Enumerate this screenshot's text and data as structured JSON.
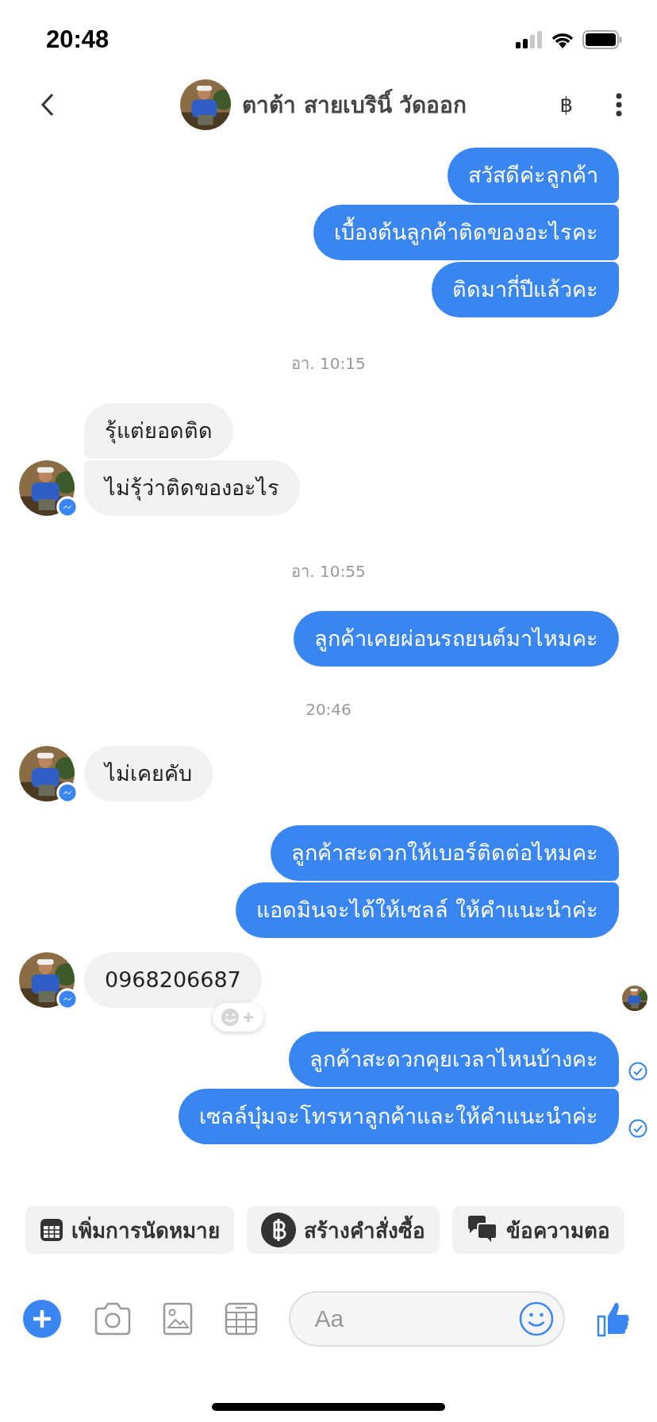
{
  "status_bar": {
    "time": "20:48"
  },
  "header": {
    "contact_name": "ตาต้า สายเบรินิ์ วัดออก",
    "currency_symbol": "฿"
  },
  "thread": [
    {
      "kind": "outgoing",
      "messages": [
        {
          "text": "สวัสดีค่ะลูกค้า",
          "delivered": false
        },
        {
          "text": "เบื้องต้นลูกค้าติดของอะไรคะ",
          "delivered": false
        },
        {
          "text": "ติดมากี่ปีแล้วคะ",
          "delivered": false
        }
      ]
    },
    {
      "kind": "time",
      "text": "อา. 10:15"
    },
    {
      "kind": "incoming",
      "messages": [
        {
          "text": "รุ้แต่ยอดติด",
          "reaction_button": false,
          "read_marker": false
        },
        {
          "text": "ไม่รุ้ว่าติดของอะไร",
          "reaction_button": false,
          "read_marker": false
        }
      ]
    },
    {
      "kind": "time",
      "text": "อา. 10:55"
    },
    {
      "kind": "outgoing",
      "messages": [
        {
          "text": "ลูกค้าเคยผ่อนรถยนต์มาไหมคะ",
          "delivered": false
        }
      ]
    },
    {
      "kind": "time",
      "text": "20:46"
    },
    {
      "kind": "incoming",
      "messages": [
        {
          "text": "ไม่เคยคับ",
          "reaction_button": false,
          "read_marker": false
        }
      ]
    },
    {
      "kind": "outgoing",
      "messages": [
        {
          "text": "ลูกค้าสะดวกให้เบอร์ติดต่อไหมคะ",
          "delivered": false
        },
        {
          "text": "แอดมินจะได้ให้เซลล์ ให้คำแนะนำค่ะ",
          "delivered": false
        }
      ]
    },
    {
      "kind": "incoming",
      "messages": [
        {
          "text": "0968206687",
          "reaction_button": true,
          "read_marker": true
        }
      ]
    },
    {
      "kind": "outgoing",
      "messages": [
        {
          "text": "ลูกค้าสะดวกคุยเวลาไหนบ้างคะ",
          "delivered": true
        },
        {
          "text": "เซลล์บุ๋มจะโทรหาลูกค้าและให้คำแนะนำค่ะ",
          "delivered": true
        }
      ]
    }
  ],
  "quick_replies": [
    {
      "kind": "calendar",
      "label": "เพิ่มการนัดหมาย"
    },
    {
      "kind": "baht",
      "label": "สร้างคำสั่งซื้อ"
    },
    {
      "kind": "chat",
      "label": "ข้อความตอ"
    }
  ],
  "composer": {
    "placeholder": "Aa"
  }
}
